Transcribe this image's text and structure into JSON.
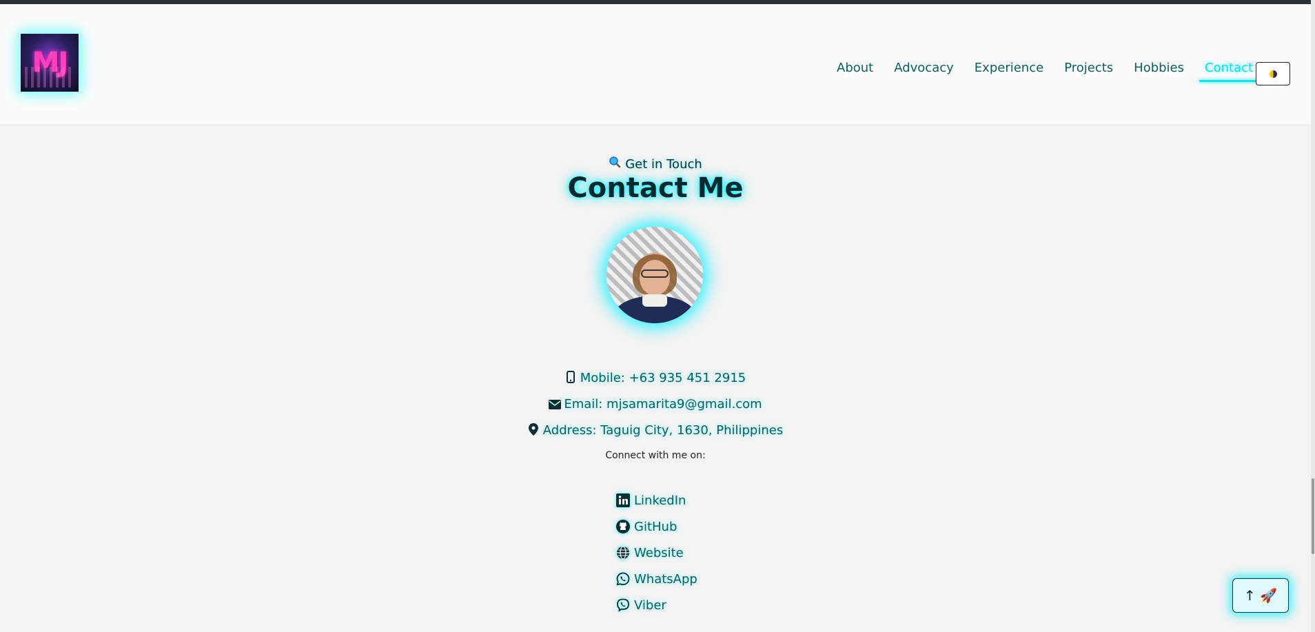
{
  "nav": {
    "items": [
      {
        "label": "About"
      },
      {
        "label": "Advocacy"
      },
      {
        "label": "Experience"
      },
      {
        "label": "Projects"
      },
      {
        "label": "Hobbies"
      },
      {
        "label": "Contact",
        "active": true
      }
    ]
  },
  "logo": {
    "text": "MJ"
  },
  "section": {
    "kicker": "Get in Touch",
    "kicker_icon": "magnifier-icon",
    "title": "Contact Me"
  },
  "contact": {
    "mobile": "Mobile: +63 935 451 2915",
    "email": "Email: mjsamarita9@gmail.com",
    "address": "Address: Taguig City, 1630, Philippines",
    "connect_label": "Connect with me on:"
  },
  "social": [
    {
      "label": "LinkedIn",
      "icon": "linkedin-icon"
    },
    {
      "label": "GitHub",
      "icon": "github-icon"
    },
    {
      "label": "Website",
      "icon": "globe-icon"
    },
    {
      "label": "WhatsApp",
      "icon": "whatsapp-icon"
    },
    {
      "label": "Viber",
      "icon": "viber-icon"
    }
  ],
  "back_to_top": {
    "label": "↑ 🚀"
  },
  "colors": {
    "accent": "#00e5f0",
    "text": "#0b5f5f",
    "heading": "#062a2e"
  }
}
